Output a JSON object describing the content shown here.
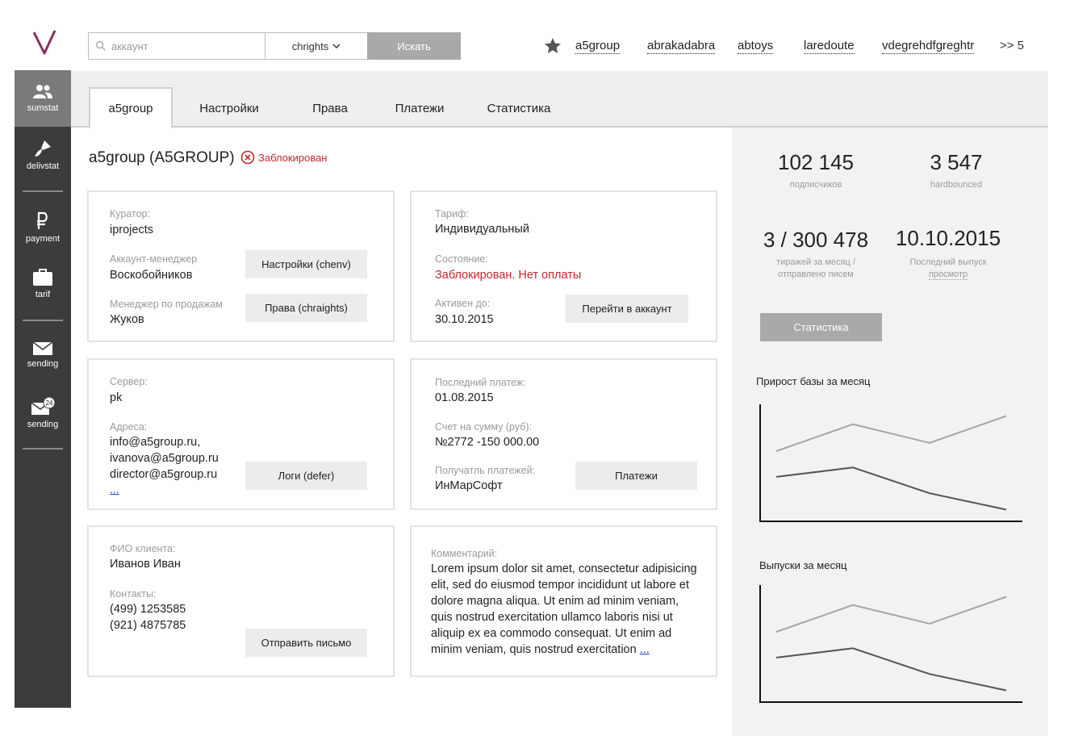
{
  "search": {
    "placeholder": "аккаунт",
    "scope_value": "chrights",
    "button_label": "Искать"
  },
  "favorites": {
    "items": [
      "a5group",
      "abrakadabra",
      "abtoys",
      "laredoute",
      "vdegrehdfgreghtr"
    ],
    "more_label": ">> 5"
  },
  "sidebar": {
    "items": [
      {
        "label": "sumstat",
        "icon": "users-icon",
        "active": true
      },
      {
        "label": "delivstat",
        "icon": "brush-icon"
      },
      {
        "label": "payment",
        "icon": "ruble-icon"
      },
      {
        "label": "tarif",
        "icon": "briefcase-icon"
      },
      {
        "label": "sending",
        "icon": "envelope-icon"
      },
      {
        "label": "sending",
        "icon": "envelope-badge-icon",
        "badge": "24"
      }
    ]
  },
  "tabs": [
    "a5group",
    "Настройки",
    "Права",
    "Платежи",
    "Статистика"
  ],
  "account": {
    "title": "a5group (A5GROUP)",
    "status": "Заблокирован"
  },
  "card_managers": {
    "curator_label": "Куратор:",
    "curator_value": "iprojects",
    "account_manager_label": "Аккаунт-менеджер",
    "account_manager_value": "Воскобойников",
    "sales_manager_label": "Менеджер по продажам",
    "sales_manager_value": "Жуков",
    "settings_button": "Настройки (chenv)",
    "rights_button": "Права (chraights)"
  },
  "card_tariff": {
    "tariff_label": "Тариф:",
    "tariff_value": "Индивидуальный",
    "state_label": "Состояние:",
    "state_value": "Заблокирован. Нет оплаты",
    "active_until_label": "Активен до:",
    "active_until_value": "30.10.2015",
    "go_button": "Перейти в аккаунт"
  },
  "card_server": {
    "server_label": "Сервер:",
    "server_value": "pk",
    "addresses_label": "Адреса:",
    "addresses": [
      "info@a5group.ru,",
      "ivanova@a5group.ru",
      "director@a5group.ru"
    ],
    "more_link": "...",
    "logs_button": "Логи (defer)"
  },
  "card_payments": {
    "last_payment_label": "Последний платеж:",
    "last_payment_value": "01.08.2015",
    "invoice_label": "Счет на сумму (руб):",
    "invoice_value": "№2772 -150 000.00",
    "receiver_label": "Получатль платежей:",
    "receiver_value": "ИнМарСофт",
    "payments_button": "Платежи"
  },
  "card_client": {
    "name_label": "ФИО клиента:",
    "name_value": "Иванов Иван",
    "contacts_label": "Контакты:",
    "phones": [
      "(499) 1253585",
      "(921) 4875785"
    ],
    "send_button": "Отправить письмо"
  },
  "card_comment": {
    "comment_label": "Комментарий:",
    "lines": [
      "Lorem ipsum dolor sit amet, consectetur adipisicing",
      "elit, sed do eiusmod tempor incididunt ut labore et",
      "dolore magna aliqua. Ut enim ad minim veniam,",
      "quis nostrud exercitation ullamco laboris nisi ut",
      "aliquip ex ea commodo consequat. Ut enim ad",
      "minim veniam, quis nostrud exercitation"
    ],
    "more_link": "..."
  },
  "stats": {
    "subscribers_value": "102 145",
    "subscribers_label": "подписчиков",
    "hardbounced_value": "3 547",
    "hardbounced_label": "hardbounced",
    "runs_value": "3 / 300 478",
    "runs_label_1": "тиражей за месяц /",
    "runs_label_2": "отправлено писем",
    "last_release_value": "10.10.2015",
    "last_release_label": "Последний выпуск",
    "last_release_link": "просмотр",
    "stats_button": "Статистика"
  },
  "chart_data": [
    {
      "type": "line",
      "title": "Прирост базы за месяц",
      "x": [
        1,
        2,
        3,
        4
      ],
      "series": [
        {
          "values": [
            0.6,
            0.83,
            0.67,
            0.9
          ],
          "color": "#a6a6a6"
        },
        {
          "values": [
            0.38,
            0.46,
            0.24,
            0.1
          ],
          "color": "#555555"
        }
      ]
    },
    {
      "type": "line",
      "title": "Выпуски за месяц",
      "x": [
        1,
        2,
        3,
        4
      ],
      "series": [
        {
          "values": [
            0.6,
            0.83,
            0.67,
            0.9
          ],
          "color": "#a6a6a6"
        },
        {
          "values": [
            0.38,
            0.46,
            0.24,
            0.1
          ],
          "color": "#555555"
        }
      ]
    }
  ],
  "colors": {
    "accent": "#8b2f5e",
    "danger": "#c0282d",
    "sidebar": "#3c3c3c"
  }
}
